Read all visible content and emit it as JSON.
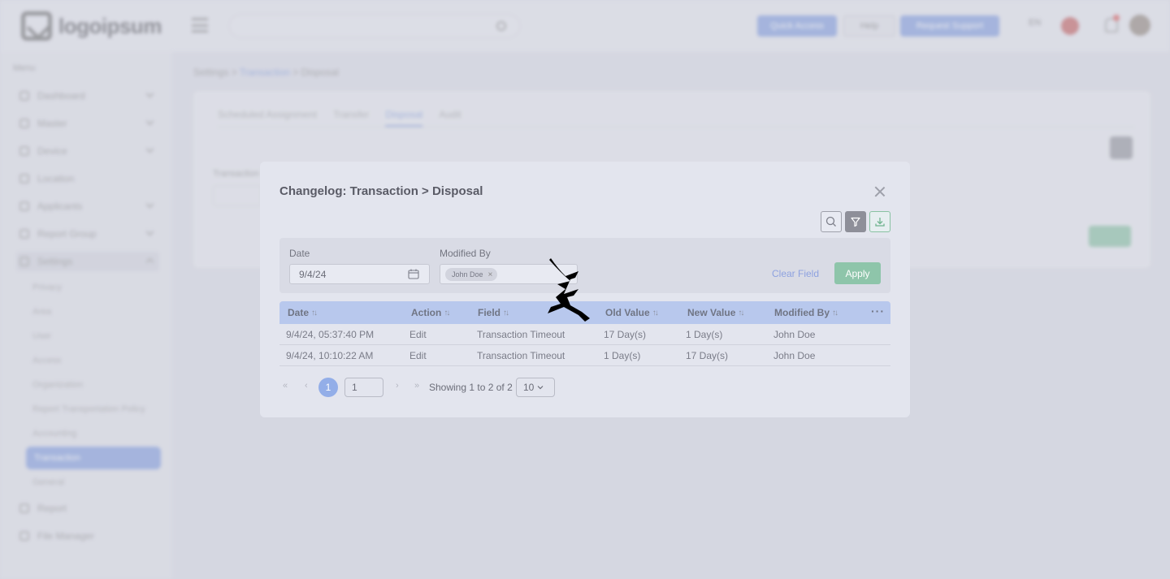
{
  "background": {
    "logo_text": "logoipsum",
    "top_buttons": [
      "Quick Access",
      "Help",
      "Request Support"
    ],
    "language": "EN",
    "menu_title": "Menu",
    "sidebar_items": [
      "Dashboard",
      "Master",
      "Device",
      "Location",
      "Applicants",
      "Report Group",
      "Settings",
      "Report",
      "File Manager"
    ],
    "settings_subitems": [
      "Privacy",
      "Area",
      "User",
      "Access",
      "Organization",
      "Report Transportation Policy",
      "Accounting",
      "Transaction",
      "General"
    ],
    "active_subitem": "Transaction",
    "breadcrumb": [
      "Settings",
      "Transaction",
      "Disposal"
    ],
    "tabs": [
      "Scheduled Assignment",
      "Transfer",
      "Disposal",
      "Audit"
    ],
    "active_tab": "Disposal",
    "field_label": "Transaction Timeout"
  },
  "modal": {
    "title": "Changelog: Transaction > Disposal",
    "toolbar": {
      "search_icon": "search-icon",
      "filter_icon": "filter-icon",
      "download_icon": "download-icon"
    },
    "filters": {
      "date_label": "Date",
      "date_value": "9/4/24",
      "modified_by_label": "Modified By",
      "modified_by_chip": "John Doe",
      "clear_label": "Clear Field",
      "apply_label": "Apply"
    },
    "table": {
      "columns": [
        "Date",
        "Action",
        "Field",
        "Old Value",
        "New Value",
        "Modified By"
      ],
      "rows": [
        [
          "9/4/24, 05:37:40 PM",
          "Edit",
          "Transaction Timeout",
          "17 Day(s)",
          "1 Day(s)",
          "John Doe"
        ],
        [
          "9/4/24, 10:10:22 AM",
          "Edit",
          "Transaction Timeout",
          "1 Day(s)",
          "17 Day(s)",
          "John Doe"
        ]
      ]
    },
    "pagination": {
      "current_page": "1",
      "page_input": "1",
      "info": "Showing 1 to 2 of 2",
      "page_size": "10"
    }
  },
  "colors": {
    "accent": "#8ea2e0",
    "apply": "#8ec5aa",
    "table_header": "#b8c8ed"
  }
}
